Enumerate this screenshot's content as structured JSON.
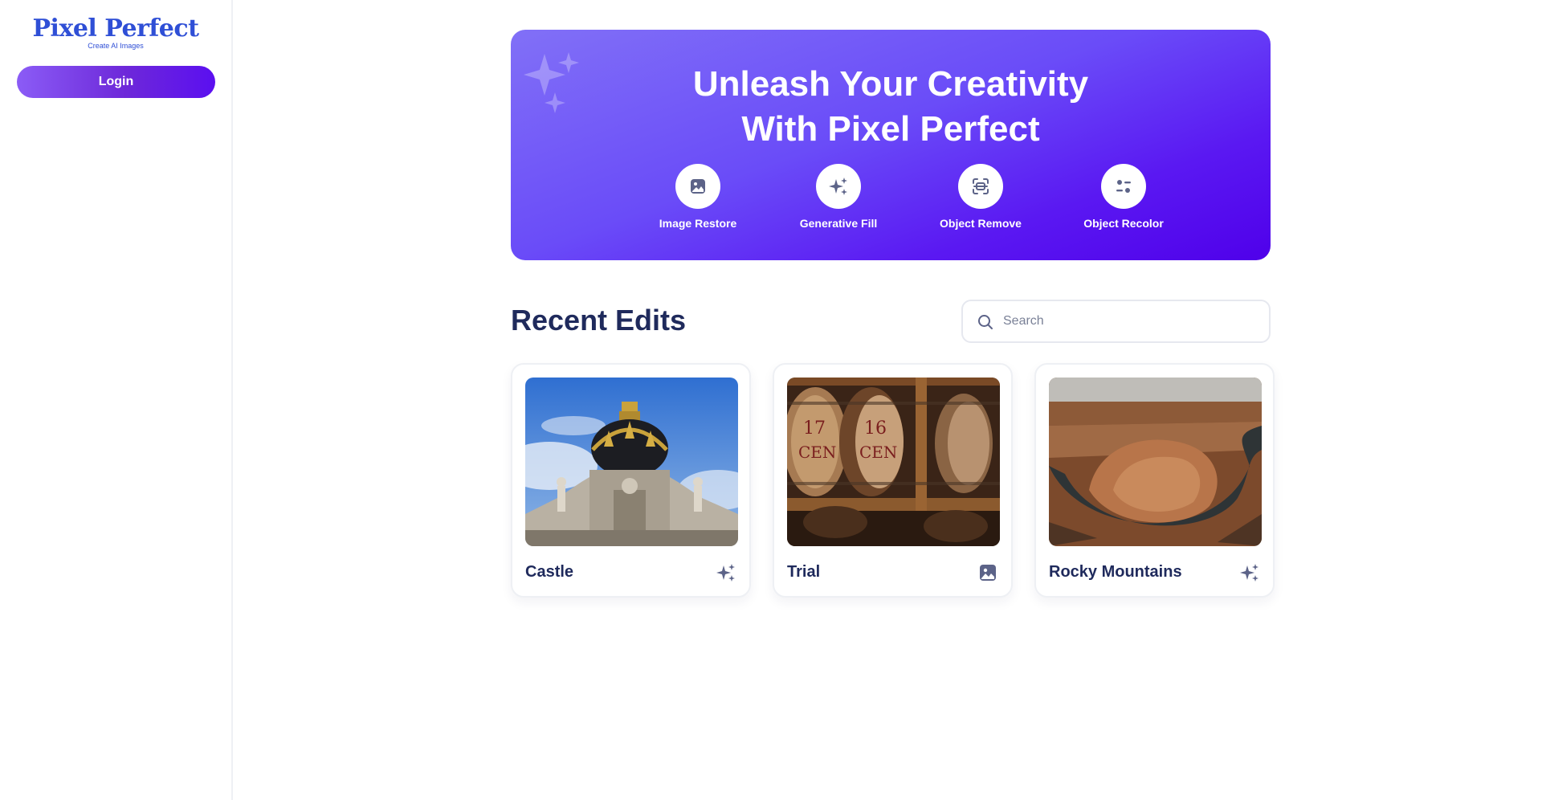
{
  "sidebar": {
    "logo": {
      "title": "Pixel Perfect",
      "subtitle": "Create AI Images"
    },
    "login_label": "Login"
  },
  "hero": {
    "title_line1": "Unleash Your Creativity",
    "title_line2": "With Pixel Perfect",
    "features": [
      {
        "label": "Image Restore",
        "icon": "image-icon"
      },
      {
        "label": "Generative Fill",
        "icon": "sparkles-icon"
      },
      {
        "label": "Object Remove",
        "icon": "scan-object-icon"
      },
      {
        "label": "Object Recolor",
        "icon": "sliders-icon"
      }
    ]
  },
  "recent": {
    "title": "Recent Edits",
    "search_placeholder": "Search",
    "cards": [
      {
        "title": "Castle",
        "thumbnail": "castle-photo",
        "tool_icon": "sparkles-icon"
      },
      {
        "title": "Trial",
        "thumbnail": "wine-barrels-photo",
        "tool_icon": "image-icon"
      },
      {
        "title": "Rocky Mountains",
        "thumbnail": "canyon-photo",
        "tool_icon": "sparkles-icon"
      }
    ]
  },
  "colors": {
    "brand": "#2f4fd6",
    "hero_gradient_start": "#8170f7",
    "hero_gradient_end": "#4f00ea",
    "text_dark": "#1f2a5c",
    "icon_muted": "#5c6388"
  }
}
